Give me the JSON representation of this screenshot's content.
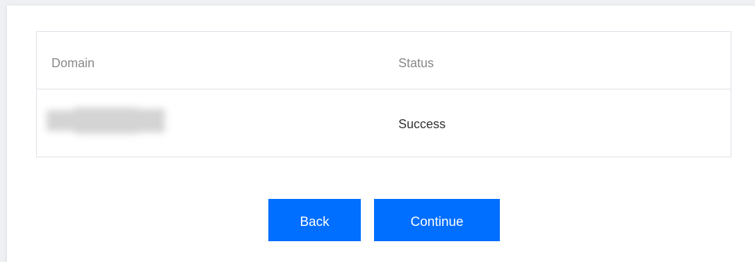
{
  "table": {
    "headers": {
      "domain": "Domain",
      "status": "Status"
    },
    "rows": [
      {
        "domain": "",
        "status": "Success"
      }
    ]
  },
  "actions": {
    "back_label": "Back",
    "continue_label": "Continue"
  },
  "colors": {
    "primary_button": "#006eff",
    "border": "#dcdfe6",
    "header_text": "#888888",
    "body_text": "#333333"
  }
}
